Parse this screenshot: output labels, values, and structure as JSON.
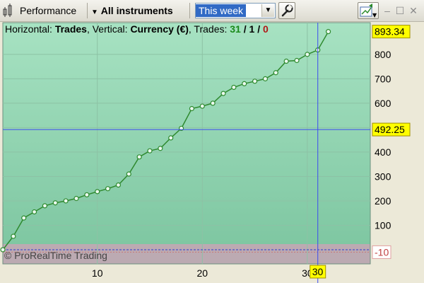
{
  "toolbar": {
    "title": "Performance",
    "instruments_label": "All instruments",
    "period_value": "This week"
  },
  "info": {
    "h_label": "Horizontal:",
    "h_value": "Trades",
    "v_label": ", Vertical:",
    "v_value": "Currency (€)",
    "trades_label": ", Trades:",
    "wins": "31",
    "sep1": " / ",
    "neutral": "1",
    "sep2": " / ",
    "losses": "0"
  },
  "copyright": "© ProRealTime Trading",
  "colors": {
    "profit_area": "#93d5b3",
    "loss_area": "#bcaab2",
    "line": "#2f8a2f",
    "crosshair": "#3c4cf0",
    "highlight": "#ffff00"
  },
  "chart_data": {
    "type": "line",
    "xlabel": "",
    "ylabel": "",
    "x": [
      1,
      2,
      3,
      4,
      5,
      6,
      7,
      8,
      9,
      10,
      11,
      12,
      13,
      14,
      15,
      16,
      17,
      18,
      19,
      20,
      21,
      22,
      23,
      24,
      25,
      26,
      27,
      28,
      29,
      30,
      31,
      32
    ],
    "y": [
      0,
      55,
      130,
      155,
      180,
      192,
      200,
      210,
      225,
      238,
      250,
      265,
      310,
      380,
      405,
      415,
      458,
      497,
      578,
      588,
      600,
      640,
      665,
      680,
      690,
      700,
      725,
      772,
      775,
      800,
      818,
      893.34
    ],
    "x_ticks": [
      "10",
      "20",
      "30"
    ],
    "x_tick_values": [
      10,
      20,
      30
    ],
    "y_ticks": [
      "100",
      "200",
      "300",
      "400",
      "500",
      "600",
      "700",
      "800"
    ],
    "y_tick_values": [
      100,
      200,
      300,
      400,
      500,
      600,
      700,
      800
    ],
    "xlim": [
      1,
      36
    ],
    "ylim": [
      -58,
      930
    ],
    "grid": true,
    "last_value_label": "893.34",
    "crosshair_y_label": "492.25",
    "crosshair_y": 492.25,
    "crosshair_x_label": "30",
    "crosshair_x": 31,
    "loss_axis_label": "-10",
    "loss_axis_value": -10
  }
}
